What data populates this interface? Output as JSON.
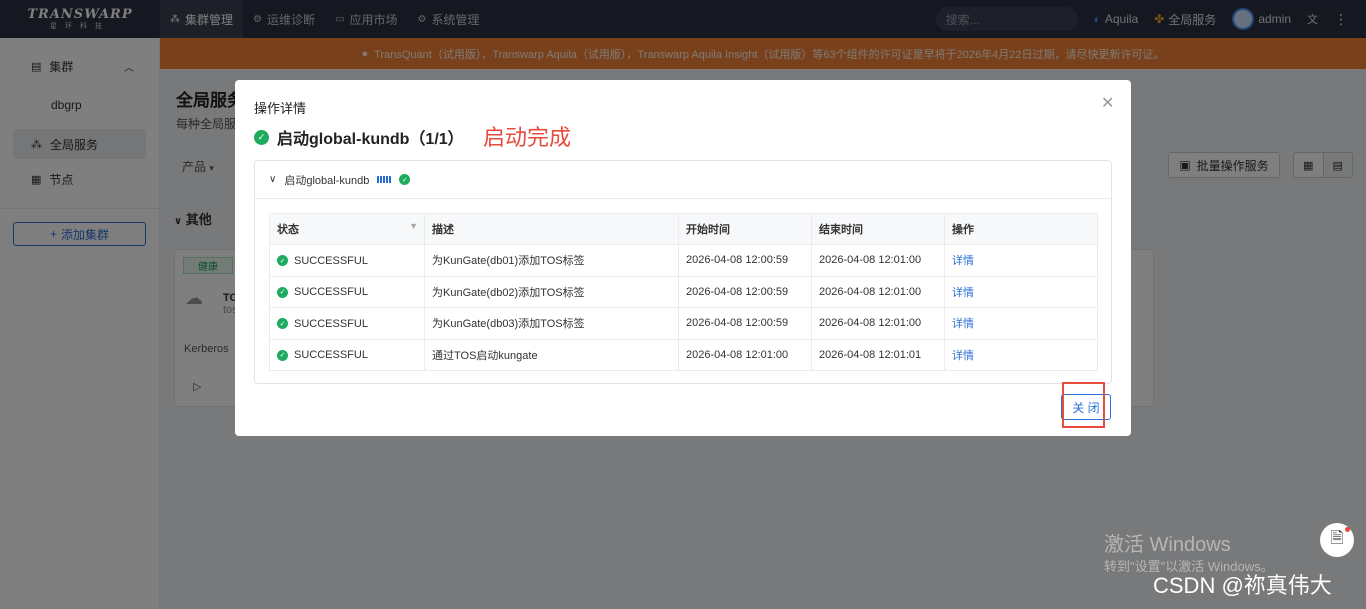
{
  "topbar": {
    "logo_main": "TRANSWARP",
    "logo_sub": "星环科技",
    "tabs": [
      {
        "label": "集群管理",
        "icon": "cluster-icon",
        "active": true
      },
      {
        "label": "运维诊断",
        "icon": "diagnose-icon",
        "active": false
      },
      {
        "label": "应用市场",
        "icon": "market-icon",
        "active": false
      },
      {
        "label": "系统管理",
        "icon": "gear-icon",
        "active": false
      }
    ],
    "search_placeholder": "搜索...",
    "aquila": "Aquila",
    "global_services": "全局服务",
    "user": "admin"
  },
  "banner": {
    "text": "TransQuant（试用版），Transwarp Aquila（试用版），Transwarp Aquila Insight（试用版）等63个组件的许可证是早将于2026年4月22日过期，请尽快更新许可证。"
  },
  "sidebar": {
    "cluster_group": "集群",
    "items": [
      {
        "label": "dbgrp"
      },
      {
        "label": "全局服务"
      },
      {
        "label": "节点"
      }
    ],
    "add_cluster": "添加集群"
  },
  "main": {
    "title": "全局服务",
    "subtitle": "每种全局服务",
    "product_filter": "产品",
    "bulk_action": "批量操作服务",
    "other_section": "其他",
    "card": {
      "health": "健康",
      "name": "TO",
      "name2": "tos",
      "kerberos": "Kerberos"
    }
  },
  "modal": {
    "title": "操作详情",
    "headline": "启动global-kundb（1/1）",
    "annotation": "启动完成",
    "panel_title": "启动global-kundb",
    "columns": [
      "状态",
      "描述",
      "开始时间",
      "结束时间",
      "操作"
    ],
    "rows": [
      {
        "status": "SUCCESSFUL",
        "desc": "为KunGate(db01)添加TOS标签",
        "start": "2026-04-08 12:00:59",
        "end": "2026-04-08 12:01:00",
        "action": "详情"
      },
      {
        "status": "SUCCESSFUL",
        "desc": "为KunGate(db02)添加TOS标签",
        "start": "2026-04-08 12:00:59",
        "end": "2026-04-08 12:01:00",
        "action": "详情"
      },
      {
        "status": "SUCCESSFUL",
        "desc": "为KunGate(db03)添加TOS标签",
        "start": "2026-04-08 12:00:59",
        "end": "2026-04-08 12:01:00",
        "action": "详情"
      },
      {
        "status": "SUCCESSFUL",
        "desc": "通过TOS启动kungate",
        "start": "2026-04-08 12:01:00",
        "end": "2026-04-08 12:01:01",
        "action": "详情"
      }
    ],
    "close_label": "关 闭"
  },
  "watermark": {
    "line1": "激活 Windows",
    "line2": "转到\"设置\"以激活 Windows。",
    "csdn": "CSDN @祢真伟大"
  },
  "colors": {
    "accent": "#2d6fd6",
    "success": "#1fab5e",
    "banner": "#f08238",
    "annotation": "#e84a3d"
  }
}
